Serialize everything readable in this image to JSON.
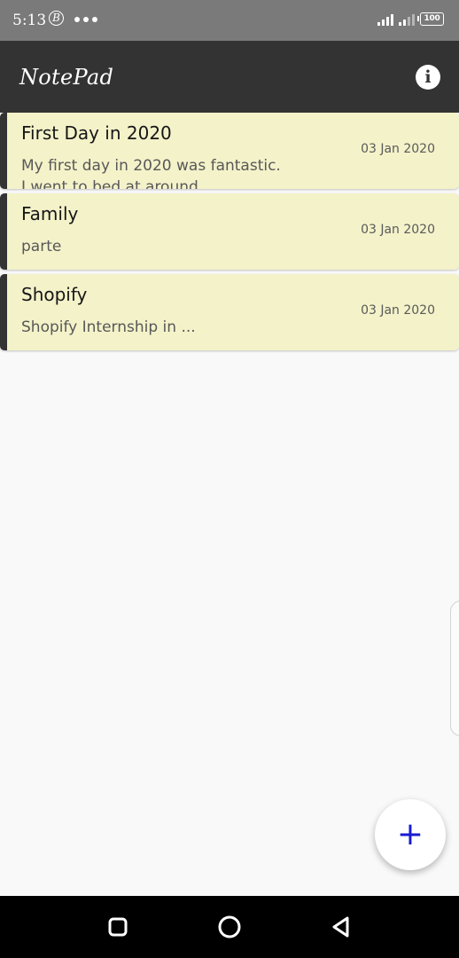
{
  "status_bar": {
    "time": "5:13",
    "b_icon_letter": "B",
    "battery": "100",
    "icons": [
      "b-circle-icon",
      "more-dots-icon",
      "signal-icon",
      "signal-icon",
      "battery-icon"
    ]
  },
  "app_bar": {
    "title": "NotePad",
    "info_icon": "i",
    "colors": {
      "background": "#333333",
      "title": "#ffffff"
    }
  },
  "notes": [
    {
      "title": "First Day in 2020",
      "preview": "My first day in 2020 was fantastic. I went to bed at around",
      "date": "03 Jan 2020"
    },
    {
      "title": "Family",
      "preview": "parte",
      "date": "03 Jan 2020"
    },
    {
      "title": "Shopify",
      "preview": "Shopify Internship in ...",
      "date": "03 Jan 2020"
    }
  ],
  "fab": {
    "label": "+",
    "icon": "add-icon",
    "color": "#1a1ad4"
  },
  "nav_bar": {
    "icons": [
      "recents-square-icon",
      "home-circle-icon",
      "back-triangle-icon"
    ]
  },
  "colors": {
    "card_background": "#f4f2c9",
    "card_accent": "#333333",
    "page_background": "#f9f9f9"
  }
}
